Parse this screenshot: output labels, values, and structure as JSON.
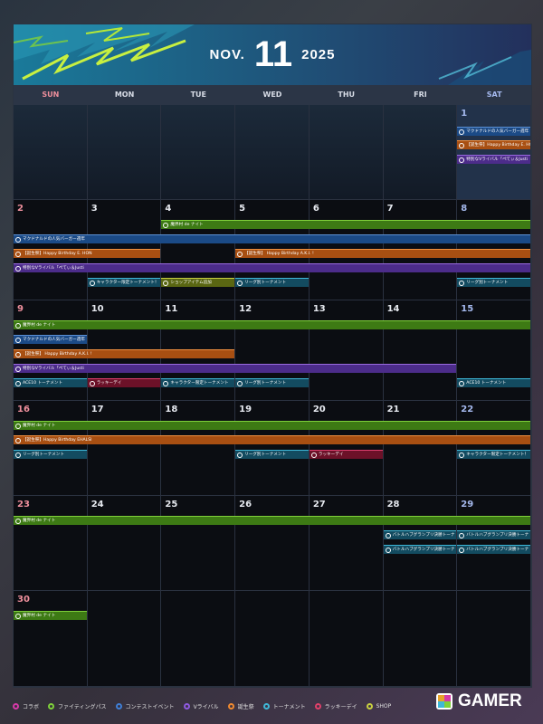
{
  "header": {
    "month": "NOV.",
    "day": "11",
    "year": "2025"
  },
  "weekdays": [
    {
      "label": "SUN",
      "color": "#ee8f9c"
    },
    {
      "label": "MON",
      "color": "#d7dce6"
    },
    {
      "label": "TUE",
      "color": "#d7dce6"
    },
    {
      "label": "WED",
      "color": "#d7dce6"
    },
    {
      "label": "THU",
      "color": "#d7dce6"
    },
    {
      "label": "FRI",
      "color": "#d7dce6"
    },
    {
      "label": "SAT",
      "color": "#a5b9ee"
    }
  ],
  "weeks": [
    [
      null,
      null,
      null,
      null,
      null,
      null,
      "1"
    ],
    [
      "2",
      "3",
      "4",
      "5",
      "6",
      "7",
      "8"
    ],
    [
      "9",
      "10",
      "11",
      "12",
      "13",
      "14",
      "15"
    ],
    [
      "16",
      "17",
      "18",
      "19",
      "20",
      "21",
      "22"
    ],
    [
      "23",
      "24",
      "25",
      "26",
      "27",
      "28",
      "29"
    ],
    [
      "30",
      null,
      null,
      null,
      null,
      null,
      null
    ]
  ],
  "events": [
    {
      "week": 0,
      "start": 6,
      "end": 6,
      "row": 0,
      "cat": "contest",
      "label": "マクドナルドの人気バーガー週年"
    },
    {
      "week": 0,
      "start": 6,
      "end": 6,
      "row": 1,
      "cat": "birth",
      "label": "【誕生祭】Happy Birthday E. HON"
    },
    {
      "week": 0,
      "start": 6,
      "end": 6,
      "row": 2,
      "cat": "revival",
      "label": "特別なVライバル「ぺてぃ＆Justi"
    },
    {
      "week": 1,
      "start": 2,
      "end": 6,
      "row": 0,
      "cat": "fight",
      "label": "魔界村 de ナイト"
    },
    {
      "week": 1,
      "start": 0,
      "end": 6,
      "row": 1,
      "cat": "contest",
      "label": "マクドナルドの人気バーガー週年"
    },
    {
      "week": 1,
      "start": 0,
      "end": 1,
      "row": 2,
      "cat": "birth",
      "label": "【誕生祭】Happy Birthday E. HON"
    },
    {
      "week": 1,
      "start": 3,
      "end": 6,
      "row": 2,
      "cat": "birth",
      "label": "【誕生祭】 Happy Birthday A.K.I. !"
    },
    {
      "week": 1,
      "start": 0,
      "end": 6,
      "row": 3,
      "cat": "revival",
      "label": "特別なVライバル「ぺてぃ＆Justi"
    },
    {
      "week": 1,
      "start": 1,
      "end": 1,
      "row": 4,
      "cat": "tour",
      "label": "キャラクター限定トーナメント！"
    },
    {
      "week": 1,
      "start": 2,
      "end": 2,
      "row": 4,
      "cat": "shop",
      "label": "ショップアイテム追加"
    },
    {
      "week": 1,
      "start": 3,
      "end": 3,
      "row": 4,
      "cat": "tour",
      "label": "リーグ別トーナメント"
    },
    {
      "week": 1,
      "start": 6,
      "end": 6,
      "row": 4,
      "cat": "tour",
      "label": "リーグ別トーナメント"
    },
    {
      "week": 2,
      "start": 0,
      "end": 6,
      "row": 0,
      "cat": "fight",
      "label": "魔界村 de ナイト"
    },
    {
      "week": 2,
      "start": 0,
      "end": 0,
      "row": 1,
      "cat": "contest",
      "label": "マクドナルドの人気バーガー週年"
    },
    {
      "week": 2,
      "start": 0,
      "end": 2,
      "row": 2,
      "cat": "birth",
      "label": "【誕生祭】 Happy Birthday A.K.I. !"
    },
    {
      "week": 2,
      "start": 0,
      "end": 5,
      "row": 3,
      "cat": "revival",
      "label": "特別なVライバル「ぺてぃ＆Justi"
    },
    {
      "week": 2,
      "start": 0,
      "end": 0,
      "row": 4,
      "cat": "tour",
      "label": "ACE10 トーナメント"
    },
    {
      "week": 2,
      "start": 1,
      "end": 1,
      "row": 4,
      "cat": "lucky",
      "label": "ラッキーデイ"
    },
    {
      "week": 2,
      "start": 2,
      "end": 2,
      "row": 4,
      "cat": "tour",
      "label": "キャラクター限定トーナメント"
    },
    {
      "week": 2,
      "start": 3,
      "end": 3,
      "row": 4,
      "cat": "tour",
      "label": "リーグ別トーナメント"
    },
    {
      "week": 2,
      "start": 6,
      "end": 6,
      "row": 4,
      "cat": "tour",
      "label": "ACE10 トーナメント"
    },
    {
      "week": 3,
      "start": 0,
      "end": 6,
      "row": 0,
      "cat": "fight",
      "label": "魔界村 de ナイト"
    },
    {
      "week": 3,
      "start": 0,
      "end": 6,
      "row": 1,
      "cat": "birth",
      "label": "【誕生祭】Happy Birthday EHALSI"
    },
    {
      "week": 3,
      "start": 0,
      "end": 0,
      "row": 2,
      "cat": "tour",
      "label": "リーグ別トーナメント"
    },
    {
      "week": 3,
      "start": 3,
      "end": 3,
      "row": 2,
      "cat": "tour",
      "label": "リーグ別トーナメント"
    },
    {
      "week": 3,
      "start": 4,
      "end": 4,
      "row": 2,
      "cat": "lucky",
      "label": "ラッキーデイ"
    },
    {
      "week": 3,
      "start": 6,
      "end": 6,
      "row": 2,
      "cat": "tour",
      "label": "キャラクター限定トーナメント！"
    },
    {
      "week": 4,
      "start": 0,
      "end": 6,
      "row": 0,
      "cat": "fight",
      "label": "魔界村 de ナイト"
    },
    {
      "week": 4,
      "start": 5,
      "end": 5,
      "row": 1,
      "cat": "tour",
      "label": "バトルハブグランプリ決勝トーナ"
    },
    {
      "week": 4,
      "start": 6,
      "end": 6,
      "row": 1,
      "cat": "tour",
      "label": "バトルハブグランプリ決勝トーナ"
    },
    {
      "week": 4,
      "start": 5,
      "end": 5,
      "row": 2,
      "cat": "tour",
      "label": "バトルハブグランプリ決勝トーナ"
    },
    {
      "week": 4,
      "start": 6,
      "end": 6,
      "row": 2,
      "cat": "tour",
      "label": "バトルハブグランプリ決勝トーナ"
    },
    {
      "week": 5,
      "start": 0,
      "end": 0,
      "row": 0,
      "cat": "fight",
      "label": "魔界村 de ナイト"
    }
  ],
  "legend": [
    {
      "label": "コラボ",
      "color": "#d63aa8"
    },
    {
      "label": "ファイティングパス",
      "color": "#7fd13a"
    },
    {
      "label": "コンテストイベント",
      "color": "#3f7fd6"
    },
    {
      "label": "Vライバル",
      "color": "#8e5ae0"
    },
    {
      "label": "誕生祭",
      "color": "#f08a30"
    },
    {
      "label": "トーナメント",
      "color": "#3fb8d8"
    },
    {
      "label": "ラッキーデイ",
      "color": "#e0406a"
    },
    {
      "label": "SHOP",
      "color": "#c8d040"
    }
  ],
  "logo": {
    "text": "GAMER"
  }
}
